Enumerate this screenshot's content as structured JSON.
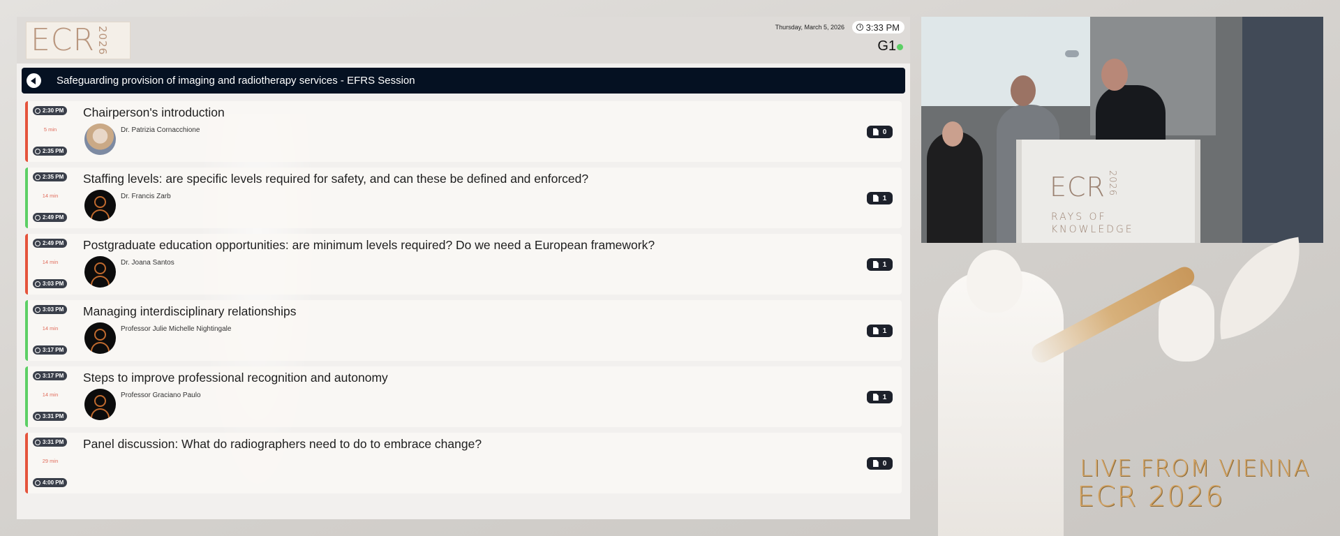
{
  "header": {
    "logo": "ECR 2026",
    "date": "Thursday, March 5, 2026",
    "time": "3:33 PM",
    "room": "G1",
    "live_color": "#5ccf65"
  },
  "session": {
    "title": "Safeguarding provision of imaging and radiotherapy services - EFRS Session"
  },
  "agenda": [
    {
      "start": "2:30 PM",
      "duration": "5 min",
      "end": "2:35 PM",
      "title": "Chairperson's introduction",
      "speaker": "Dr. Patrizia Cornacchione",
      "docs": "0",
      "avatar": "photo",
      "status_color": "#e5533c"
    },
    {
      "start": "2:35 PM",
      "duration": "14 min",
      "end": "2:49 PM",
      "title": "Staffing levels: are specific levels required for safety, and can these be defined and enforced?",
      "speaker": "Dr. Francis Zarb",
      "docs": "1",
      "avatar": "generic",
      "status_color": "#5ccf65"
    },
    {
      "start": "2:49 PM",
      "duration": "14 min",
      "end": "3:03 PM",
      "title": "Postgraduate education opportunities: are minimum levels required? Do we need a European framework?",
      "speaker": "Dr. Joana Santos",
      "docs": "1",
      "avatar": "generic",
      "status_color": "#e5533c"
    },
    {
      "start": "3:03 PM",
      "duration": "14 min",
      "end": "3:17 PM",
      "title": "Managing interdisciplinary relationships",
      "speaker": "Professor Julie Michelle Nightingale",
      "docs": "1",
      "avatar": "generic",
      "status_color": "#5ccf65"
    },
    {
      "start": "3:17 PM",
      "duration": "14 min",
      "end": "3:31 PM",
      "title": "Steps to improve professional recognition and autonomy",
      "speaker": "Professor Graciano Paulo",
      "docs": "1",
      "avatar": "generic",
      "status_color": "#5ccf65"
    },
    {
      "start": "3:31 PM",
      "duration": "29 min",
      "end": "4:00 PM",
      "title": "Panel discussion: What do radiographers need to do to embrace change?",
      "speaker": "",
      "docs": "0",
      "avatar": "none",
      "status_color": "#e5533c"
    }
  ],
  "video": {
    "podium_logo": "ECR 2026",
    "podium_tagline_1": "RAYS OF",
    "podium_tagline_2": "KNOWLEDGE"
  },
  "overlay": {
    "line1": "LIVE FROM VIENNA",
    "line2": "ECR 2026"
  }
}
